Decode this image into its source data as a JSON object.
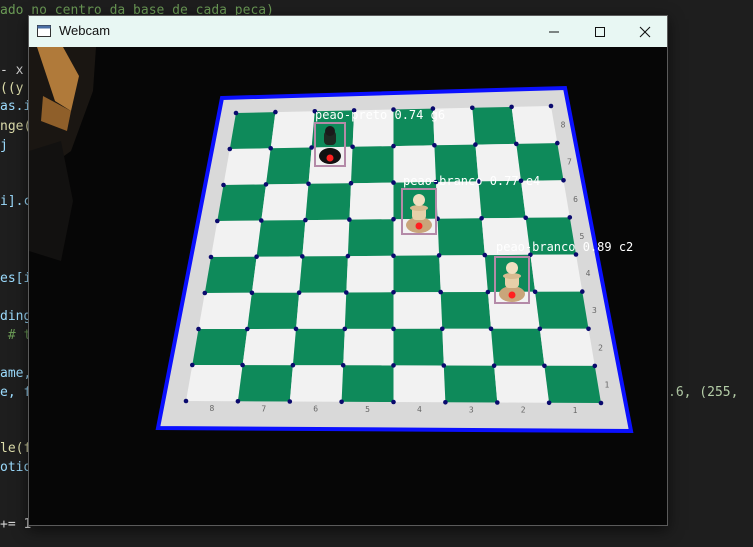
{
  "editor": {
    "lines": [
      {
        "text": "ado no centro da base de cada peca)",
        "class": "c-comment"
      },
      {
        "text": "- x",
        "class": ""
      },
      {
        "text": "((y",
        "class": "c-yellow"
      },
      {
        "text": "as.i",
        "class": "c-blue"
      },
      {
        "text": "nge(",
        "class": "c-yellow"
      },
      {
        "text": "j",
        "class": "c-blue"
      },
      {
        "text": "i].c",
        "class": "c-blue"
      },
      {
        "text": "es[i",
        "class": "c-blue"
      },
      {
        "text": "ding",
        "class": "c-blue"
      },
      {
        "text": " # t",
        "class": "c-comment"
      },
      {
        "text": "ame,",
        "class": "c-blue"
      },
      {
        "text": "e, f",
        "class": "c-blue"
      },
      {
        "text": ".6, (255,",
        "class": "c-num"
      },
      {
        "text": "le(f",
        "class": "c-yellow"
      },
      {
        "text": "otio",
        "class": "c-blue"
      },
      {
        "text": "+= 1",
        "class": ""
      }
    ]
  },
  "window": {
    "title": "Webcam",
    "icon": "app-window-icon",
    "controls": [
      "minimize-icon",
      "maximize-icon",
      "close-icon"
    ]
  },
  "board": {
    "outline_color": "#0b10ff",
    "dark_color": "#0e8a5a",
    "light_color": "#f2f2f2",
    "files_bottom": [
      "8",
      "7",
      "6",
      "5",
      "4",
      "3",
      "2",
      "1"
    ],
    "ranks_right": [
      "8",
      "7",
      "6",
      "5",
      "4",
      "3",
      "2",
      "1"
    ]
  },
  "detections": [
    {
      "label": "peao-preto 0.74 g6",
      "piece": "black-pawn"
    },
    {
      "label": "peao-branco 0.77 e4",
      "piece": "white-pawn"
    },
    {
      "label": "peao-branco 0.89 c2",
      "piece": "white-pawn"
    }
  ]
}
